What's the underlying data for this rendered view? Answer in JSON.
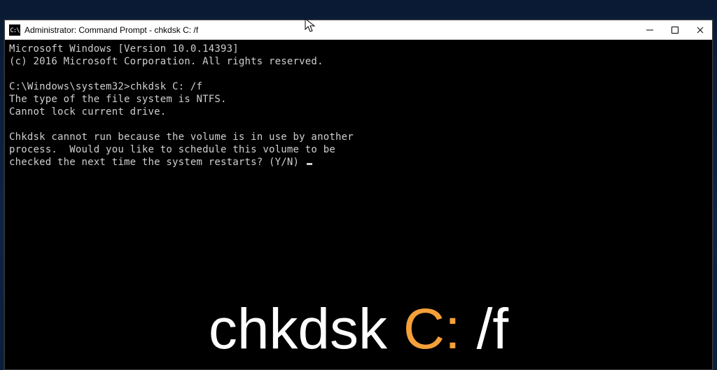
{
  "titlebar": {
    "icon_label": "C:\\",
    "title": "Administrator: Command Prompt - chkdsk  C: /f"
  },
  "window_controls": {
    "minimize": "Minimize",
    "maximize": "Maximize",
    "close": "Close"
  },
  "terminal": {
    "banner_line1": "Microsoft Windows [Version 10.0.14393]",
    "banner_line2": "(c) 2016 Microsoft Corporation. All rights reserved.",
    "prompt_path": "C:\\Windows\\system32>",
    "prompt_command": "chkdsk C: /f",
    "fs_line": "The type of the file system is NTFS.",
    "lock_line": "Cannot lock current drive.",
    "msg_line1": "Chkdsk cannot run because the volume is in use by another",
    "msg_line2": "process.  Would you like to schedule this volume to be",
    "msg_line3": "checked the next time the system restarts? (Y/N) "
  },
  "overlay": {
    "part1": "chkdsk ",
    "part2": "C:",
    "part3": " /f"
  }
}
